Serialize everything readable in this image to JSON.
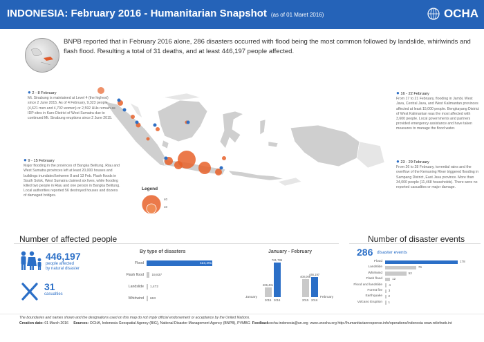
{
  "header": {
    "title": "INDONESIA: February 2016 - Humanitarian Snapshot",
    "title_prefix": "INDONESIA:",
    "title_rest": " February 2016 - Humanitarian Snapshot",
    "as_of": "(as of  01 Maret 2016)",
    "org": "OCHA",
    "bg_color": "#2563b8"
  },
  "intro_text": "BNPB reported that in February 2016 alone, 286 disasters occurred with flood  being the most common followed by landslide, whirlwinds and flash flood. Resulting a total of 31 deaths, and at least 446,197 people affected.",
  "callouts": {
    "c1": {
      "head": "2 - 8 February",
      "body": "Mt. Sinabung is maintained at Level 4 (the highest) since 2 June 2015. As of 4 February, 9,323 people (4,621 men and 4,702 women) or 2,592 HHs remain as IDP sites in Karo District of West Sumatra due to continued Mt. Sinabung eruptions since 2 June 2015."
    },
    "c2": {
      "head": "9 - 15 February",
      "body": "Major flooding in the provinces of Bangka Belitung, Riau and West Sumatra provinces left at least 20,000 houses and buildings inundated between 8 and 13 Feb. Flash floods in South Solok, West Sumatra claimed six lives, while flooding killed two people in Riau and one person in Bangka Belitung. Local authorities reported 56 destroyed houses and dozens of damaged bridges."
    },
    "c3": {
      "head": "16 - 22 February",
      "body": "From 17 to 21 February, flooding in Jambi, West Java, Central Java, and West Kalimantan provinces affected at least 15,000 people. Bengkayang District of West Kalimantan was the most affected with 3,600 people. Local governments and partners provided emergency assistance and have taken measures to manage the flood water."
    },
    "c4": {
      "head": "23 - 29 February",
      "body": "From 26 to 28 February, torrential rains and the overflow of the Kemuning River triggered flooding in Sampang District, East Java province. More than 34,000 people (11,468 households). There were no reported casualties or major damage."
    }
  },
  "legend": {
    "title": "Legend",
    "v1": "40",
    "v2": "10"
  },
  "affected": {
    "section_title": "Number of affected people",
    "people_value": "446,197",
    "people_label_1": "people affected",
    "people_label_2": "by natural disaster",
    "casualties_value": "31",
    "casualties_label": "casualties"
  },
  "by_type": {
    "title": "By type of disasters",
    "categories": [
      "Flood",
      "Flash flood",
      "Landslide",
      "Whirlwind"
    ],
    "values": [
      423491,
      19837,
      1472,
      663
    ],
    "value_labels": [
      "423,491",
      "19,837",
      "1,472",
      "663"
    ],
    "color_primary": "#2b6fc7",
    "color_secondary": "#c9c9c9"
  },
  "jan_feb": {
    "title": "January - February",
    "groups": [
      {
        "name": "January",
        "bars": [
          {
            "year": "2015",
            "value": 206401,
            "label": "206,401"
          },
          {
            "year": "2016",
            "value": 761786,
            "label": "761,786"
          }
        ]
      },
      {
        "name": "February",
        "bars": [
          {
            "year": "2015",
            "value": 400006,
            "label": "400,006"
          },
          {
            "year": "2016",
            "value": 446197,
            "label": "446,197"
          }
        ]
      }
    ]
  },
  "events": {
    "section_title": "Number of disaster events",
    "total": "286",
    "total_label": "disaster events",
    "categories": [
      "Flood",
      "Landslide",
      "Whirlwind",
      "Flash flood",
      "Flood and landslide",
      "Forest fire",
      "Earthquake",
      "Volcano Eruption"
    ],
    "values": [
      178,
      76,
      52,
      12,
      4,
      3,
      2,
      1
    ]
  },
  "chart_data": [
    {
      "type": "bar",
      "title": "By type of disasters",
      "categories": [
        "Flood",
        "Flash flood",
        "Landslide",
        "Whirlwind"
      ],
      "values": [
        423491,
        19837,
        1472,
        663
      ]
    },
    {
      "type": "bar",
      "title": "January - February",
      "categories": [
        "January",
        "February"
      ],
      "series": [
        {
          "name": "2015",
          "values": [
            206401,
            400006
          ]
        },
        {
          "name": "2016",
          "values": [
            761786,
            446197
          ]
        }
      ]
    },
    {
      "type": "bar",
      "title": "",
      "categories": [
        "Flood",
        "Landslide",
        "Whirlwind",
        "Flash flood",
        "Flood and landslide",
        "Forest fire",
        "Earthquake",
        "Volcano Eruption"
      ],
      "values": [
        178,
        76,
        52,
        12,
        4,
        3,
        2,
        1
      ]
    }
  ],
  "footer": {
    "disclaimer": "The boundaries and names shown and the designations used on this map do not imply official endorsement or acceptance by the United Nations.",
    "creation_label": "Creation date:",
    "creation_value": " 01 March 2016",
    "sources_label": "Sources:",
    "sources_value": " OCHA, Indonesia Geospatial Agency (BIG), National Disaster Management Agency (BNPB), PVMBG",
    "feedback_label": "Feedback:",
    "feedback_value": "ocha-indonesia@un.org",
    "links": "www.unocha.org   http://humanitarianresponse.info/operations/indonesia   www.reliefweb.int"
  }
}
